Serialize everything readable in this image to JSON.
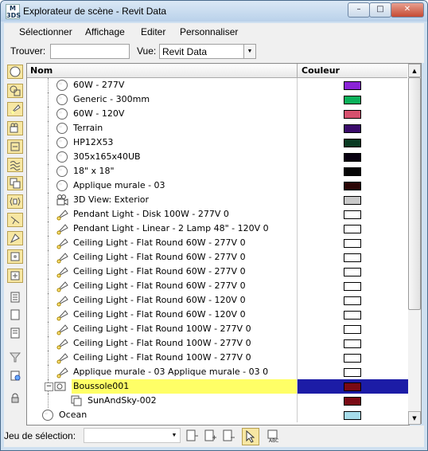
{
  "window": {
    "title": "Explorateur de scène - Revit Data",
    "app_icon_text": "M\n3DS",
    "minimize": "–",
    "maximize": "□",
    "close": "✕"
  },
  "menu": [
    "Sélectionner",
    "Affichage",
    "Editer",
    "Personnaliser"
  ],
  "search": {
    "find_label": "Trouver:",
    "find_value": "",
    "view_label": "Vue:",
    "view_value": "Revit Data"
  },
  "columns": {
    "name": "Nom",
    "color": "Couleur"
  },
  "rows": [
    {
      "label": "60W - 277V",
      "icon": "sphere-icon",
      "color": "#8a23d6"
    },
    {
      "label": "Generic - 300mm",
      "icon": "sphere-icon",
      "color": "#0bb15a"
    },
    {
      "label": "60W - 120V",
      "icon": "sphere-icon",
      "color": "#d6506e"
    },
    {
      "label": "Terrain",
      "icon": "sphere-icon",
      "color": "#3a0a6a"
    },
    {
      "label": "HP12X53",
      "icon": "sphere-icon",
      "color": "#093a22"
    },
    {
      "label": "305x165x40UB",
      "icon": "sphere-icon",
      "color": "#080010"
    },
    {
      "label": "18\" x 18\"",
      "icon": "sphere-icon",
      "color": "#050505"
    },
    {
      "label": "Applique murale - 03",
      "icon": "sphere-icon",
      "color": "#2a0505"
    },
    {
      "label": "3D View: Exterior",
      "icon": "camera-icon",
      "color": "#c8c8c8"
    },
    {
      "label": "Pendant Light - Disk 100W - 277V 0",
      "icon": "light-icon",
      "color": "#ffffff"
    },
    {
      "label": "Pendant Light - Linear - 2 Lamp 48\" - 120V 0",
      "icon": "light-icon",
      "color": "#ffffff"
    },
    {
      "label": "Ceiling Light - Flat Round 60W - 277V 0",
      "icon": "light-icon",
      "color": "#ffffff"
    },
    {
      "label": "Ceiling Light - Flat Round 60W - 277V 0",
      "icon": "light-icon",
      "color": "#ffffff"
    },
    {
      "label": "Ceiling Light - Flat Round 60W - 277V 0",
      "icon": "light-icon",
      "color": "#ffffff"
    },
    {
      "label": "Ceiling Light - Flat Round 60W - 277V 0",
      "icon": "light-icon",
      "color": "#ffffff"
    },
    {
      "label": "Ceiling Light - Flat Round 60W - 120V 0",
      "icon": "light-icon",
      "color": "#ffffff"
    },
    {
      "label": "Ceiling Light - Flat Round 60W - 120V 0",
      "icon": "light-icon",
      "color": "#ffffff"
    },
    {
      "label": "Ceiling Light - Flat Round 100W - 277V 0",
      "icon": "light-icon",
      "color": "#ffffff"
    },
    {
      "label": "Ceiling Light - Flat Round 100W - 277V 0",
      "icon": "light-icon",
      "color": "#ffffff"
    },
    {
      "label": "Ceiling Light - Flat Round 100W - 277V 0",
      "icon": "light-icon",
      "color": "#ffffff"
    },
    {
      "label": "Applique murale - 03 Applique murale - 03 0",
      "icon": "light-icon",
      "color": "#ffffff"
    },
    {
      "label": "Boussole001",
      "icon": "compass-icon",
      "color": "#7a0a14",
      "selected": true,
      "expander": "−"
    },
    {
      "label": "SunAndSky-002",
      "icon": "sun-icon",
      "color": "#7a0a14"
    },
    {
      "label": "Ocean",
      "icon": "sphere-icon",
      "color": "#a6dcea"
    }
  ],
  "bottom": {
    "selection_set_label": "Jeu de sélection:",
    "selection_set_value": ""
  },
  "scroll": {
    "up": "▲",
    "down": "▼"
  }
}
